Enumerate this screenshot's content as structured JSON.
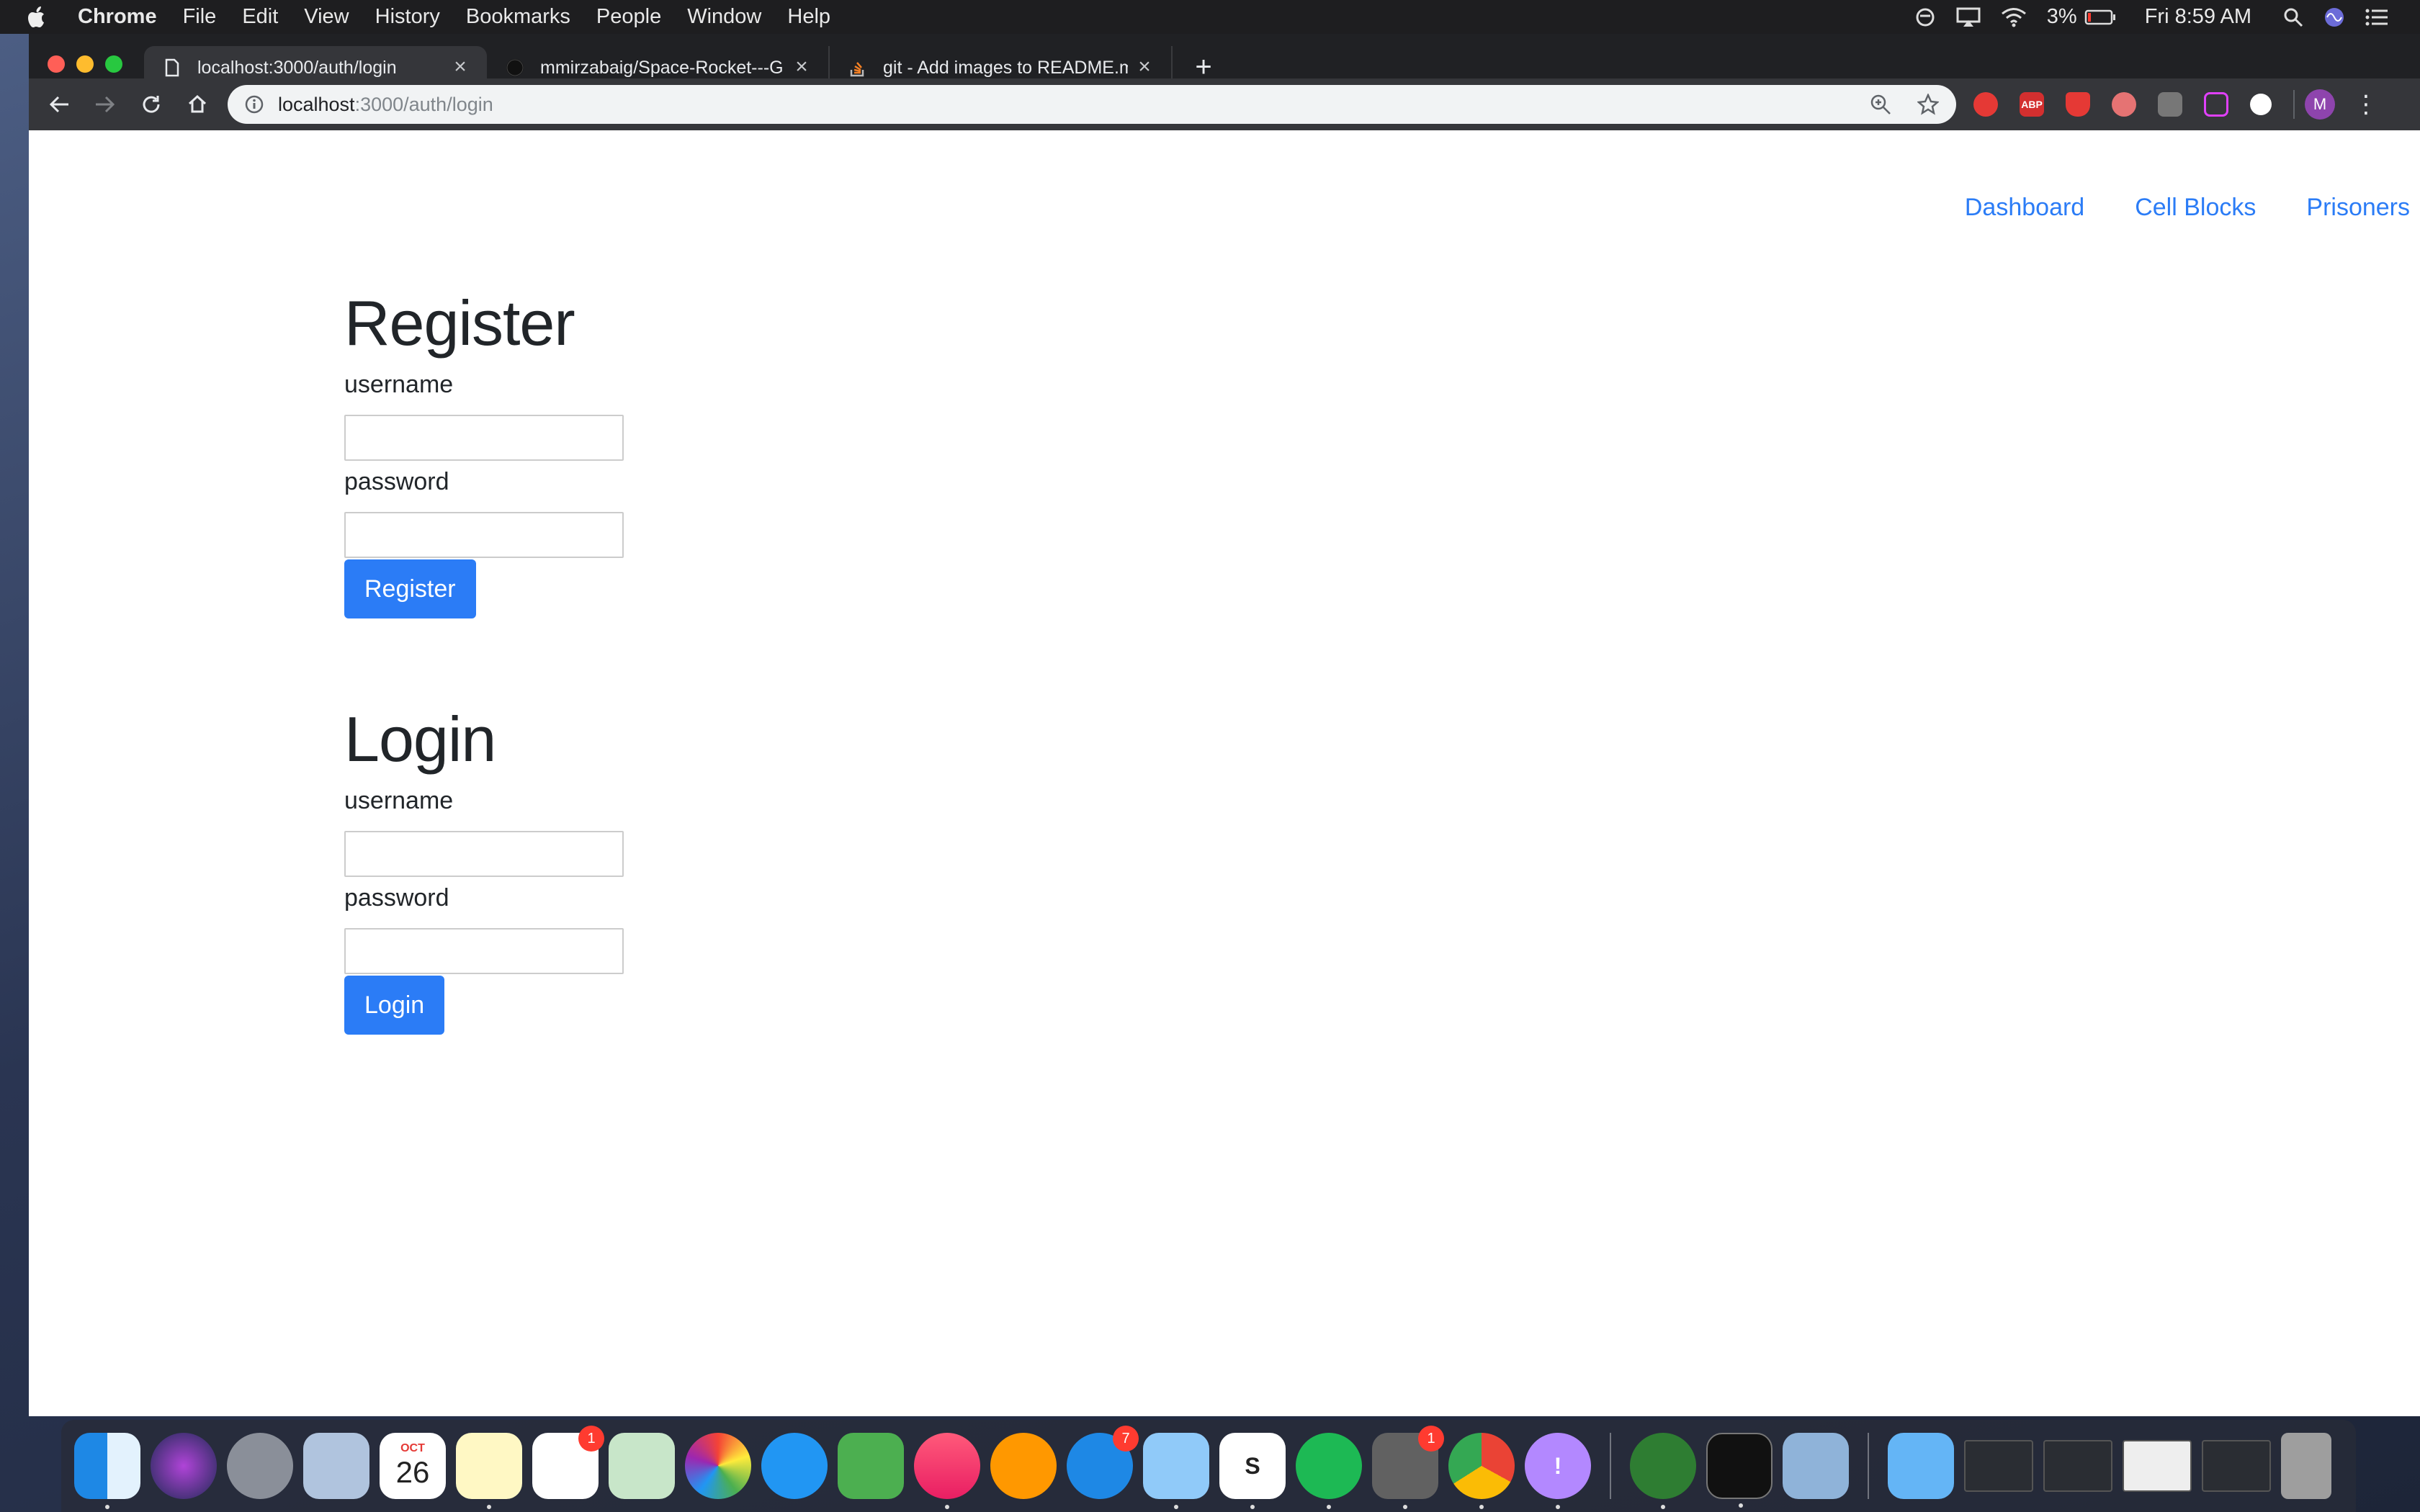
{
  "menubar": {
    "app_name": "Chrome",
    "items": [
      "File",
      "Edit",
      "View",
      "History",
      "Bookmarks",
      "People",
      "Window",
      "Help"
    ],
    "battery": "3%",
    "clock": "Fri 8:59 AM"
  },
  "browser": {
    "tabs": [
      {
        "title": "localhost:3000/auth/login",
        "icon": "document-icon"
      },
      {
        "title": "mmirzabaig/Space-Rocket---G",
        "icon": "github-icon"
      },
      {
        "title": "git - Add images to README.m",
        "icon": "stackoverflow-icon"
      }
    ],
    "url_host": "localhost",
    "url_path": ":3000/auth/login",
    "avatar_letter": "M",
    "extensions": [
      "ABP"
    ]
  },
  "page": {
    "nav": [
      "Dashboard",
      "Cell Blocks",
      "Prisoners"
    ],
    "register": {
      "heading": "Register",
      "username_label": "username",
      "password_label": "password",
      "username_value": "",
      "password_value": "",
      "button": "Register"
    },
    "login": {
      "heading": "Login",
      "username_label": "username",
      "password_label": "password",
      "username_value": "",
      "password_value": "",
      "button": "Login"
    }
  },
  "dock": {
    "calendar_month": "OCT",
    "calendar_day": "26",
    "badges": {
      "reminders": "1",
      "app_store": "7",
      "system_prefs": "1"
    }
  },
  "colors": {
    "link": "#2b7cf6",
    "button": "#2b7cf6"
  }
}
